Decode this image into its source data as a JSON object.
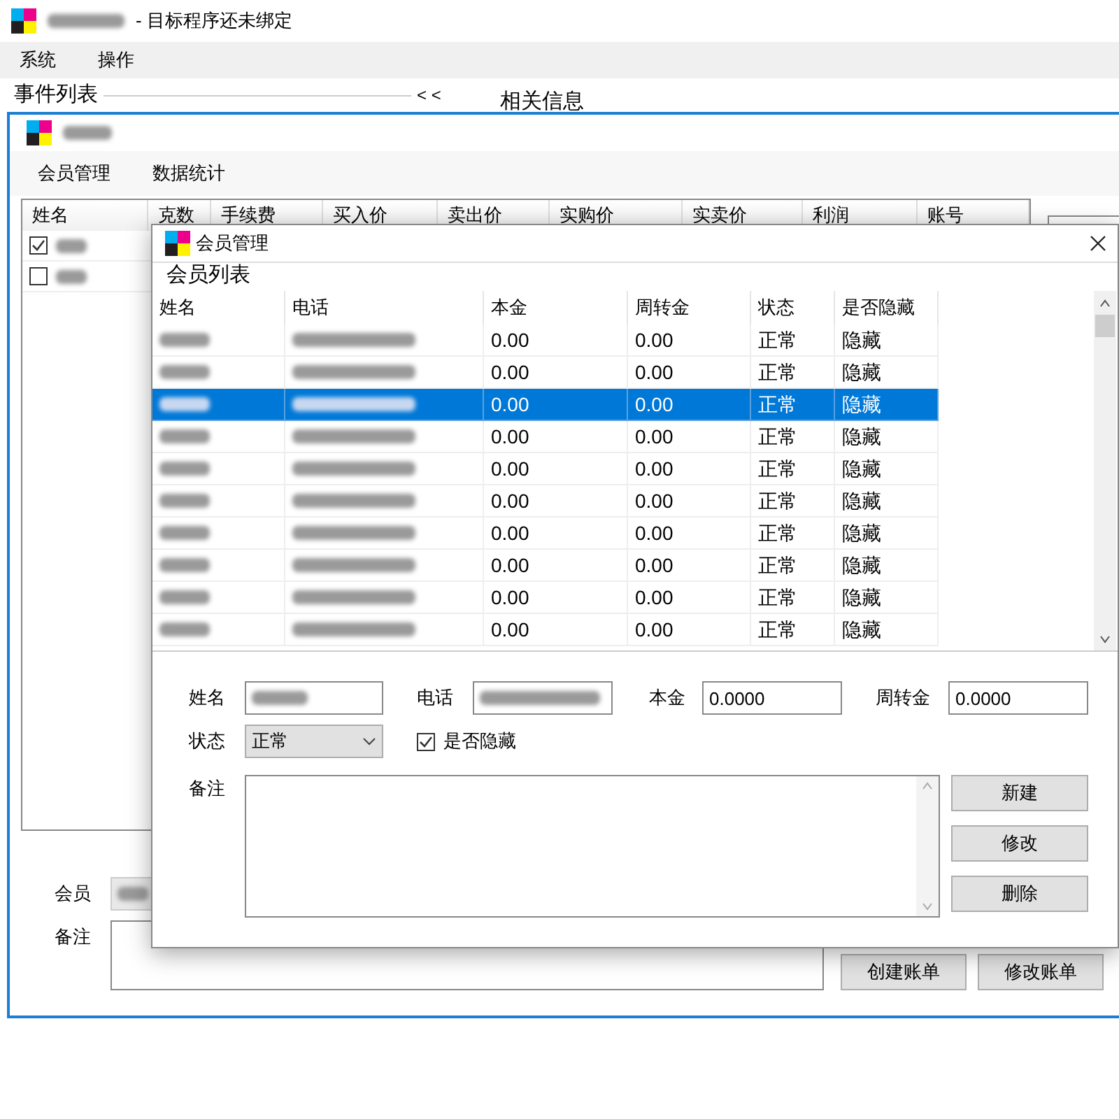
{
  "main_window": {
    "title": "- 目标程序还未绑定",
    "menu": [
      "系统",
      "操作"
    ],
    "event_group": "事件列表",
    "collapse_button": "< <",
    "info_group": "相关信息"
  },
  "sub_window": {
    "menu": [
      "会员管理",
      "数据统计"
    ],
    "columns": [
      "姓名",
      "克数",
      "手续费",
      "买入价",
      "卖出价",
      "实购价",
      "实卖价",
      "利润",
      "账号"
    ],
    "rows": [
      {
        "checked": true
      },
      {
        "checked": false
      }
    ],
    "member_label": "会员",
    "note_label": "备注",
    "buttons": [
      "创建账单",
      "修改账单"
    ]
  },
  "dialog": {
    "title": "会员管理",
    "section": "会员列表",
    "columns": [
      "姓名",
      "电话",
      "本金",
      "周转金",
      "状态",
      "是否隐藏"
    ],
    "rows": [
      {
        "principal": "0.00",
        "turnover": "0.00",
        "status": "正常",
        "hidden": "隐藏",
        "selected": false
      },
      {
        "principal": "0.00",
        "turnover": "0.00",
        "status": "正常",
        "hidden": "隐藏",
        "selected": false
      },
      {
        "principal": "0.00",
        "turnover": "0.00",
        "status": "正常",
        "hidden": "隐藏",
        "selected": true
      },
      {
        "principal": "0.00",
        "turnover": "0.00",
        "status": "正常",
        "hidden": "隐藏",
        "selected": false
      },
      {
        "principal": "0.00",
        "turnover": "0.00",
        "status": "正常",
        "hidden": "隐藏",
        "selected": false
      },
      {
        "principal": "0.00",
        "turnover": "0.00",
        "status": "正常",
        "hidden": "隐藏",
        "selected": false
      },
      {
        "principal": "0.00",
        "turnover": "0.00",
        "status": "正常",
        "hidden": "隐藏",
        "selected": false
      },
      {
        "principal": "0.00",
        "turnover": "0.00",
        "status": "正常",
        "hidden": "隐藏",
        "selected": false
      },
      {
        "principal": "0.00",
        "turnover": "0.00",
        "status": "正常",
        "hidden": "隐藏",
        "selected": false
      },
      {
        "principal": "0.00",
        "turnover": "0.00",
        "status": "正常",
        "hidden": "隐藏",
        "selected": false
      }
    ],
    "form": {
      "name_label": "姓名",
      "phone_label": "电话",
      "principal_label": "本金",
      "principal_value": "0.0000",
      "turnover_label": "周转金",
      "turnover_value": "0.0000",
      "status_label": "状态",
      "status_value": "正常",
      "hidden_label": "是否隐藏",
      "hidden_checked": true,
      "note_label": "备注",
      "buttons": [
        "新建",
        "修改",
        "删除"
      ]
    }
  }
}
